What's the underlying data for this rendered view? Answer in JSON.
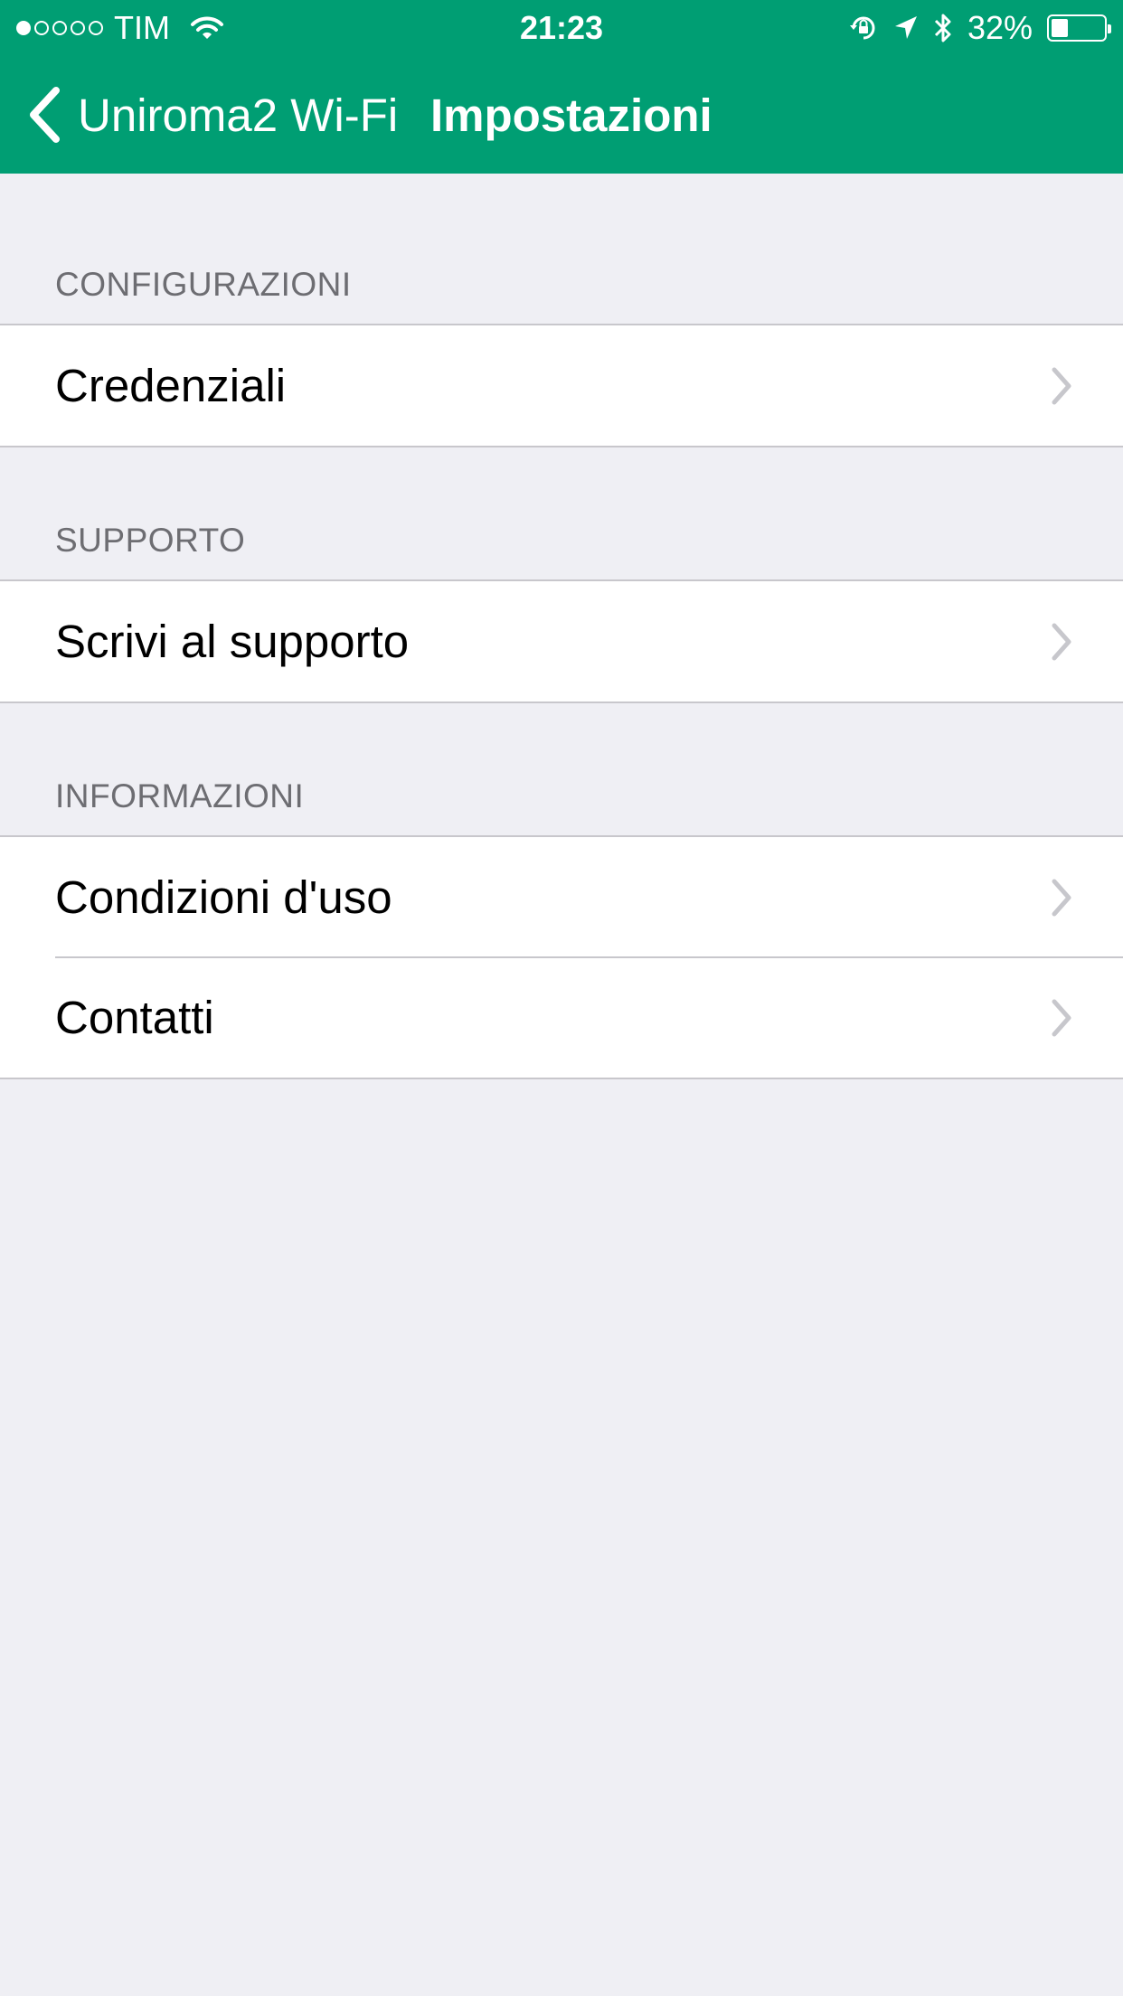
{
  "status_bar": {
    "carrier": "TIM",
    "time": "21:23",
    "battery_percent": "32%",
    "battery_level": 0.32,
    "signal_strength": 1,
    "signal_max": 5,
    "icons": [
      "wifi-icon",
      "rotation-lock-icon",
      "location-arrow-icon",
      "bluetooth-icon",
      "battery-icon"
    ]
  },
  "nav": {
    "back_label": "Uniroma2 Wi-Fi",
    "title": "Impostazioni",
    "back_icon": "chevron-left-icon"
  },
  "sections": [
    {
      "header": "CONFIGURAZIONI",
      "items": [
        {
          "label": "Credenziali"
        }
      ]
    },
    {
      "header": "SUPPORTO",
      "items": [
        {
          "label": "Scrivi al supporto"
        }
      ]
    },
    {
      "header": "INFORMAZIONI",
      "items": [
        {
          "label": "Condizioni d'uso"
        },
        {
          "label": "Contatti"
        }
      ]
    }
  ],
  "colors": {
    "header_background": "#009e73",
    "page_background": "#efeff4",
    "section_header_text": "#6d6d72",
    "separator": "#c8c7cc",
    "chevron": "#c7c7cc"
  }
}
